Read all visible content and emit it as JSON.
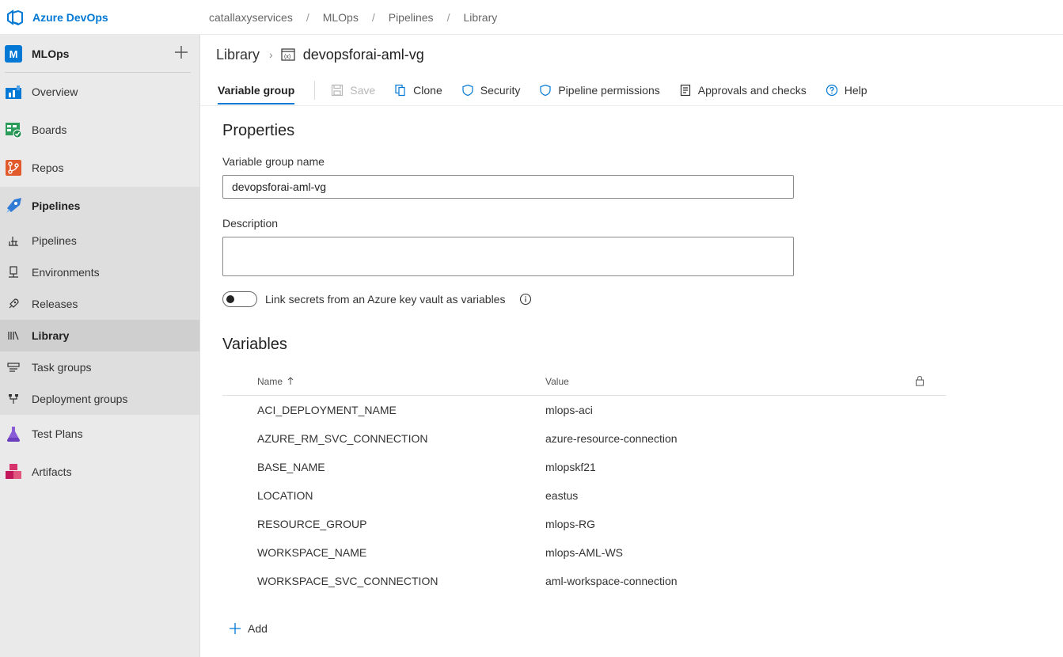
{
  "app": {
    "brand": "Azure DevOps"
  },
  "breadcrumbs": [
    "catallaxyservices",
    "MLOps",
    "Pipelines",
    "Library"
  ],
  "sidebar": {
    "project_initial": "M",
    "project_name": "MLOps",
    "items": [
      {
        "label": "Overview",
        "icon": "overview-icon"
      },
      {
        "label": "Boards",
        "icon": "boards-icon"
      },
      {
        "label": "Repos",
        "icon": "repos-icon"
      }
    ],
    "pipelines_group": {
      "label": "Pipelines",
      "sub_items": [
        {
          "label": "Pipelines",
          "icon": "pipelines-sub-icon"
        },
        {
          "label": "Environments",
          "icon": "environments-icon"
        },
        {
          "label": "Releases",
          "icon": "releases-icon"
        },
        {
          "label": "Library",
          "icon": "library-icon",
          "active": true
        },
        {
          "label": "Task groups",
          "icon": "task-groups-icon"
        },
        {
          "label": "Deployment groups",
          "icon": "deployment-groups-icon"
        }
      ]
    },
    "bottom_items": [
      {
        "label": "Test Plans",
        "icon": "test-plans-icon"
      },
      {
        "label": "Artifacts",
        "icon": "artifacts-icon"
      }
    ]
  },
  "header": {
    "library": "Library",
    "group_name": "devopsforai-aml-vg"
  },
  "toolbar": {
    "tab": "Variable group",
    "save": "Save",
    "clone": "Clone",
    "security": "Security",
    "pipeline_permissions": "Pipeline permissions",
    "approvals": "Approvals and checks",
    "help": "Help"
  },
  "properties": {
    "title": "Properties",
    "name_label": "Variable group name",
    "name_value": "devopsforai-aml-vg",
    "description_label": "Description",
    "description_value": "",
    "toggle_label": "Link secrets from an Azure key vault as variables"
  },
  "variables": {
    "title": "Variables",
    "col_name": "Name",
    "col_value": "Value",
    "rows": [
      {
        "name": "ACI_DEPLOYMENT_NAME",
        "value": "mlops-aci"
      },
      {
        "name": "AZURE_RM_SVC_CONNECTION",
        "value": "azure-resource-connection"
      },
      {
        "name": "BASE_NAME",
        "value": "mlopskf21"
      },
      {
        "name": "LOCATION",
        "value": "eastus"
      },
      {
        "name": "RESOURCE_GROUP",
        "value": "mlops-RG"
      },
      {
        "name": "WORKSPACE_NAME",
        "value": "mlops-AML-WS"
      },
      {
        "name": "WORKSPACE_SVC_CONNECTION",
        "value": "aml-workspace-connection"
      }
    ],
    "add": "Add"
  },
  "colors": {
    "accent": "#0078d4",
    "sidebar_bg": "#eaeaea"
  }
}
